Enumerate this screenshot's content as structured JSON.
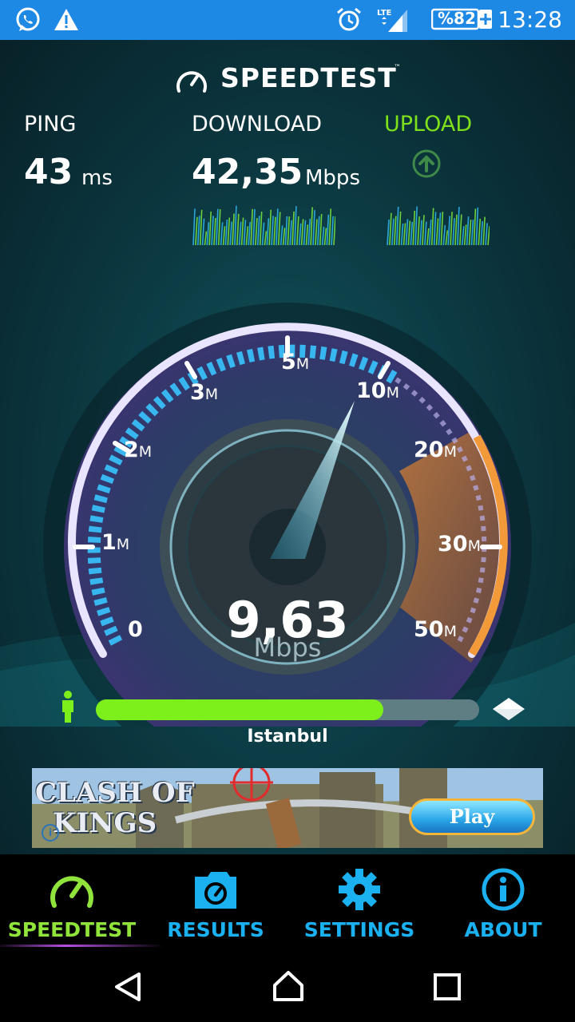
{
  "status_bar": {
    "left_icons": [
      "whatsapp-icon",
      "warning-icon"
    ],
    "right_icons": [
      "alarm-icon",
      "lte-signal-icon",
      "battery-icon"
    ],
    "network": "LTE",
    "battery": "%82",
    "time": "13:28",
    "color": "#1e88e5"
  },
  "header": {
    "title": "SPEEDTEST",
    "trademark": "™"
  },
  "metrics": {
    "ping": {
      "label": "PING",
      "value": "43",
      "unit": "ms"
    },
    "download": {
      "label": "DOWNLOAD",
      "value": "42,35",
      "unit": "Mbps"
    },
    "upload": {
      "label": "UPLOAD",
      "color": "#7ee01a"
    }
  },
  "gauge": {
    "tick_labels": [
      {
        "num": "0",
        "unit": ""
      },
      {
        "num": "1",
        "unit": "M"
      },
      {
        "num": "2",
        "unit": "M"
      },
      {
        "num": "3",
        "unit": "M"
      },
      {
        "num": "5",
        "unit": "M"
      },
      {
        "num": "10",
        "unit": "M"
      },
      {
        "num": "20",
        "unit": "M"
      },
      {
        "num": "30",
        "unit": "M"
      },
      {
        "num": "50",
        "unit": "M"
      }
    ],
    "current_value": "9,63",
    "current_unit": "Mbps",
    "needle_fraction": 0.61
  },
  "server": {
    "name": "Istanbul",
    "progress": 0.75
  },
  "ad": {
    "brand_line1": "CLASH OF",
    "brand_line2": "KINGS",
    "play_label": "Play"
  },
  "nav": [
    {
      "label": "SPEEDTEST",
      "icon": "speedometer-icon",
      "active": true,
      "color": "#8fe33a"
    },
    {
      "label": "RESULTS",
      "icon": "folder-icon",
      "active": false,
      "color": "#1bb0f0"
    },
    {
      "label": "SETTINGS",
      "icon": "gear-icon",
      "active": false,
      "color": "#1bb0f0"
    },
    {
      "label": "ABOUT",
      "icon": "info-icon",
      "active": false,
      "color": "#1bb0f0"
    }
  ],
  "system_nav": [
    "back-icon",
    "home-icon",
    "recents-icon"
  ]
}
